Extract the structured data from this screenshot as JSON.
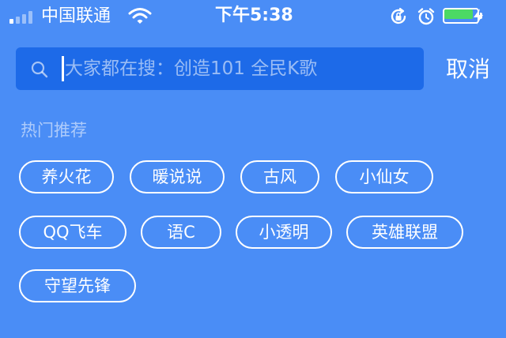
{
  "status_bar": {
    "carrier": "中国联通",
    "time": "下午5:38",
    "signal_bars": 4,
    "signal_bars_active": 1,
    "battery_level": 0.95,
    "battery_color": "#4cd964"
  },
  "search": {
    "placeholder": "大家都在搜：创造101 全民K歌",
    "cancel_label": "取消"
  },
  "hot": {
    "title": "热门推荐",
    "tags": [
      "养火花",
      "暖说说",
      "古风",
      "小仙女",
      "QQ飞车",
      "语C",
      "小透明",
      "英雄联盟",
      "守望先锋"
    ]
  },
  "colors": {
    "background": "#4a8df6",
    "search_box": "#1d6ae8"
  },
  "icons": {
    "signal": "cellular-signal-icon",
    "wifi": "wifi-icon",
    "rotation_lock": "rotation-lock-icon",
    "alarm": "alarm-icon",
    "battery": "battery-icon",
    "charging": "charging-bolt-icon",
    "search": "search-icon"
  }
}
